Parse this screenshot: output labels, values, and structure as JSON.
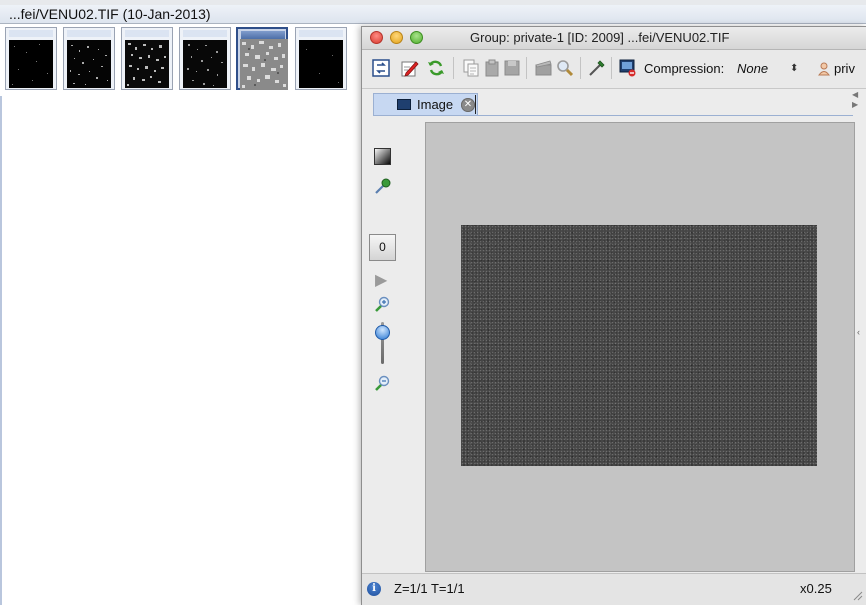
{
  "browser": {
    "title": "...fei/VENU02.TIF (10-Jan-2013)",
    "thumbnails": [
      {
        "name": "thumb-1",
        "selected": false
      },
      {
        "name": "thumb-2",
        "selected": false
      },
      {
        "name": "thumb-3",
        "selected": false
      },
      {
        "name": "thumb-4",
        "selected": false
      },
      {
        "name": "thumb-5",
        "selected": true
      },
      {
        "name": "thumb-6",
        "selected": false
      }
    ]
  },
  "viewer": {
    "title": "Group: private-1 [ID: 2009] ...fei/VENU02.TIF",
    "toolbar": {
      "compression_label": "Compression:",
      "compression_value": "None",
      "compression_arrows": "⬍",
      "user_label": "priv"
    },
    "tab": {
      "label": "Image",
      "close_glyph": "✕"
    },
    "tools": {
      "channel_button_label": "0",
      "play_glyph": "▶",
      "zoom_slider_level": 0.75
    },
    "status": {
      "info_glyph": "i",
      "position_text": "Z=1/1 T=1/1",
      "zoom_text": "x0.25"
    },
    "colors": {
      "tab_bg": "#c7d8f2",
      "canvas_bg": "#c4c4c4",
      "image_bg": "#464646"
    }
  }
}
